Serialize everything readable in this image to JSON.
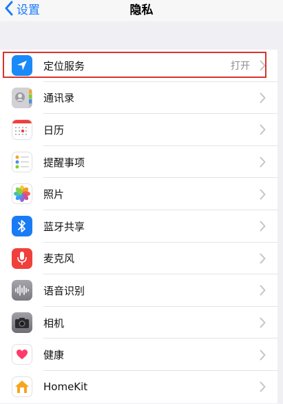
{
  "nav": {
    "back_label": "设置",
    "title": "隐私"
  },
  "rows": [
    {
      "label": "定位服务",
      "value": "打开",
      "icon": "location-arrow-icon",
      "color": "#1a8af8"
    },
    {
      "label": "通讯录",
      "value": "",
      "icon": "contacts-icon",
      "color": "#c9c9ce"
    },
    {
      "label": "日历",
      "value": "",
      "icon": "calendar-icon",
      "color": "#ffffff"
    },
    {
      "label": "提醒事项",
      "value": "",
      "icon": "reminders-icon",
      "color": "#ffffff"
    },
    {
      "label": "照片",
      "value": "",
      "icon": "photos-icon",
      "color": "#ffffff"
    },
    {
      "label": "蓝牙共享",
      "value": "",
      "icon": "bluetooth-icon",
      "color": "#1a7cf5"
    },
    {
      "label": "麦克风",
      "value": "",
      "icon": "microphone-icon",
      "color": "#f0403b"
    },
    {
      "label": "语音识别",
      "value": "",
      "icon": "speech-recognition-icon",
      "color": "#8e8e93"
    },
    {
      "label": "相机",
      "value": "",
      "icon": "camera-icon",
      "color": "#8e8e93"
    },
    {
      "label": "健康",
      "value": "",
      "icon": "health-heart-icon",
      "color": "#ffffff"
    },
    {
      "label": "HomeKit",
      "value": "",
      "icon": "homekit-house-icon",
      "color": "#ffffff"
    }
  ],
  "colors": {
    "accent": "#1a7cf5",
    "highlight": "#d9312b",
    "background": "#efeff4"
  }
}
